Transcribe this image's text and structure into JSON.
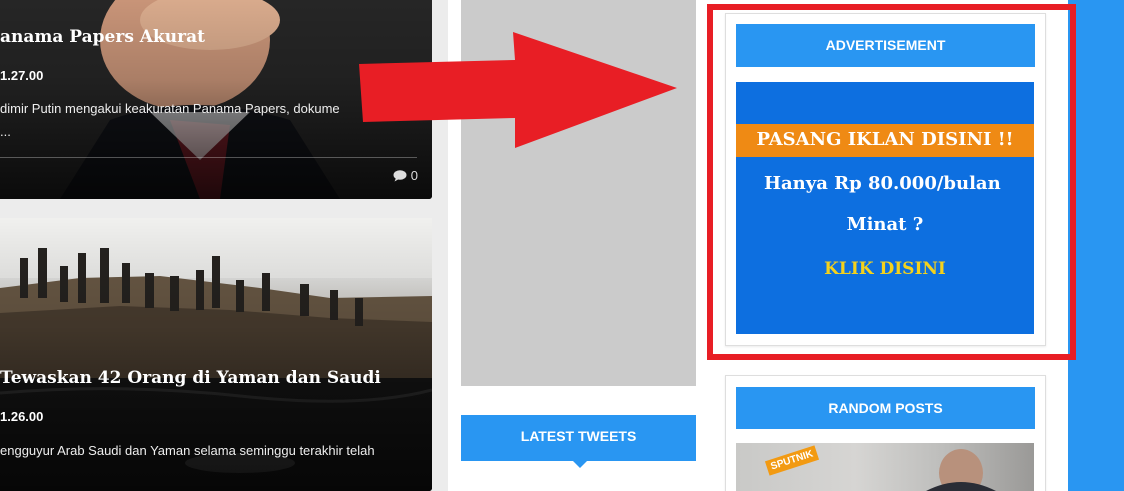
{
  "posts": [
    {
      "title": "anama Papers Akurat",
      "date": "1.27.00",
      "excerpt_line1": "dimir Putin mengakui keakuratan Panama Papers, dokume",
      "excerpt_line2": "...",
      "comments": "0"
    },
    {
      "title": "Tewaskan 42 Orang di Yaman dan Saudi",
      "date": "1.26.00",
      "excerpt_line1": "engguyur Arab Saudi dan Yaman selama seminggu terakhir telah"
    }
  ],
  "middle": {
    "tweets_heading": "LATEST TWEETS"
  },
  "sidebar": {
    "advertisement_heading": "ADVERTISEMENT",
    "ad": {
      "line1": "PASANG IKLAN DISINI !!",
      "line2": "Hanya Rp 80.000/bulan",
      "line3": "Minat ?",
      "line4": "KLIK DISINI"
    },
    "random_heading": "RANDOM POSTS",
    "random_thumb_brand": "SPUTNIK"
  },
  "icons": {
    "comment": "comment-bubble-icon",
    "annotation": "red-arrow"
  },
  "colors": {
    "accent": "#2996f2",
    "highlight": "#e81e25",
    "ad_background": "#0d6fe0",
    "ad_stripe": "#ef8a14",
    "ad_cta": "#f4d21c"
  }
}
